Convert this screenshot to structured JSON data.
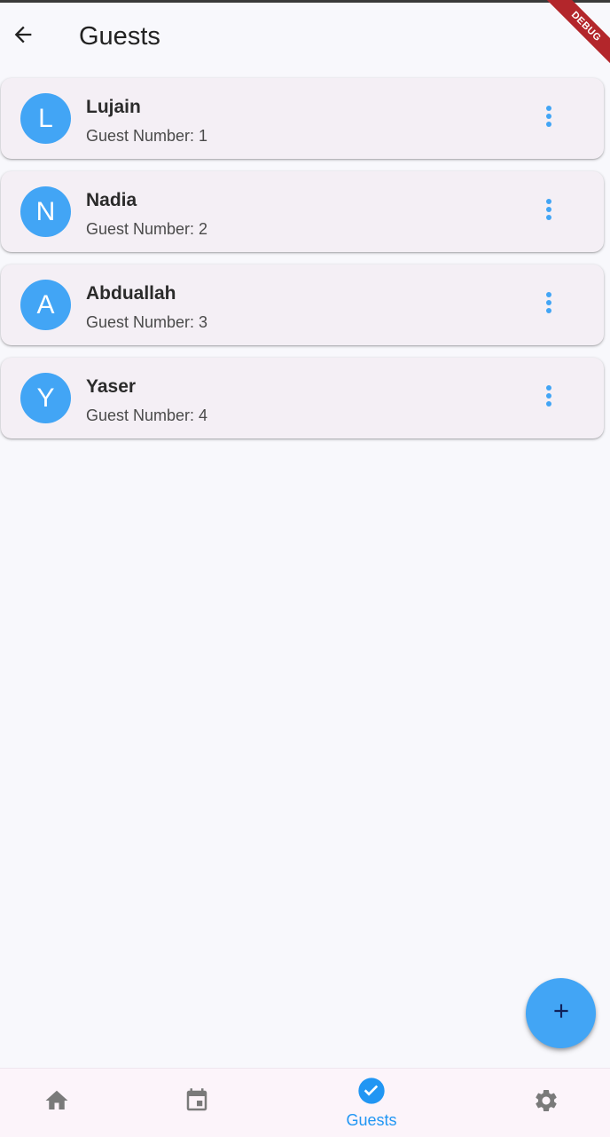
{
  "app_bar": {
    "title": "Guests",
    "back_icon": "arrow-back-icon"
  },
  "debug_banner": {
    "label": "DEBUG",
    "color": "#b3262b"
  },
  "guests": [
    {
      "initial": "L",
      "name": "Lujain",
      "subtitle": "Guest Number: 1"
    },
    {
      "initial": "N",
      "name": "Nadia",
      "subtitle": "Guest Number: 2"
    },
    {
      "initial": "A",
      "name": "Abduallah",
      "subtitle": "Guest Number: 3"
    },
    {
      "initial": "Y",
      "name": "Yaser",
      "subtitle": "Guest Number: 4"
    }
  ],
  "fab": {
    "icon": "plus-icon",
    "color": "#42a5f5"
  },
  "bottom_nav": {
    "items": [
      {
        "icon": "home-icon",
        "label": ""
      },
      {
        "icon": "calendar-icon",
        "label": ""
      },
      {
        "icon": "check-circle-icon",
        "label": "Guests",
        "selected": true
      },
      {
        "icon": "gear-icon",
        "label": ""
      }
    ],
    "accent_color": "#2196f3",
    "inactive_color": "#7a7a7a"
  }
}
